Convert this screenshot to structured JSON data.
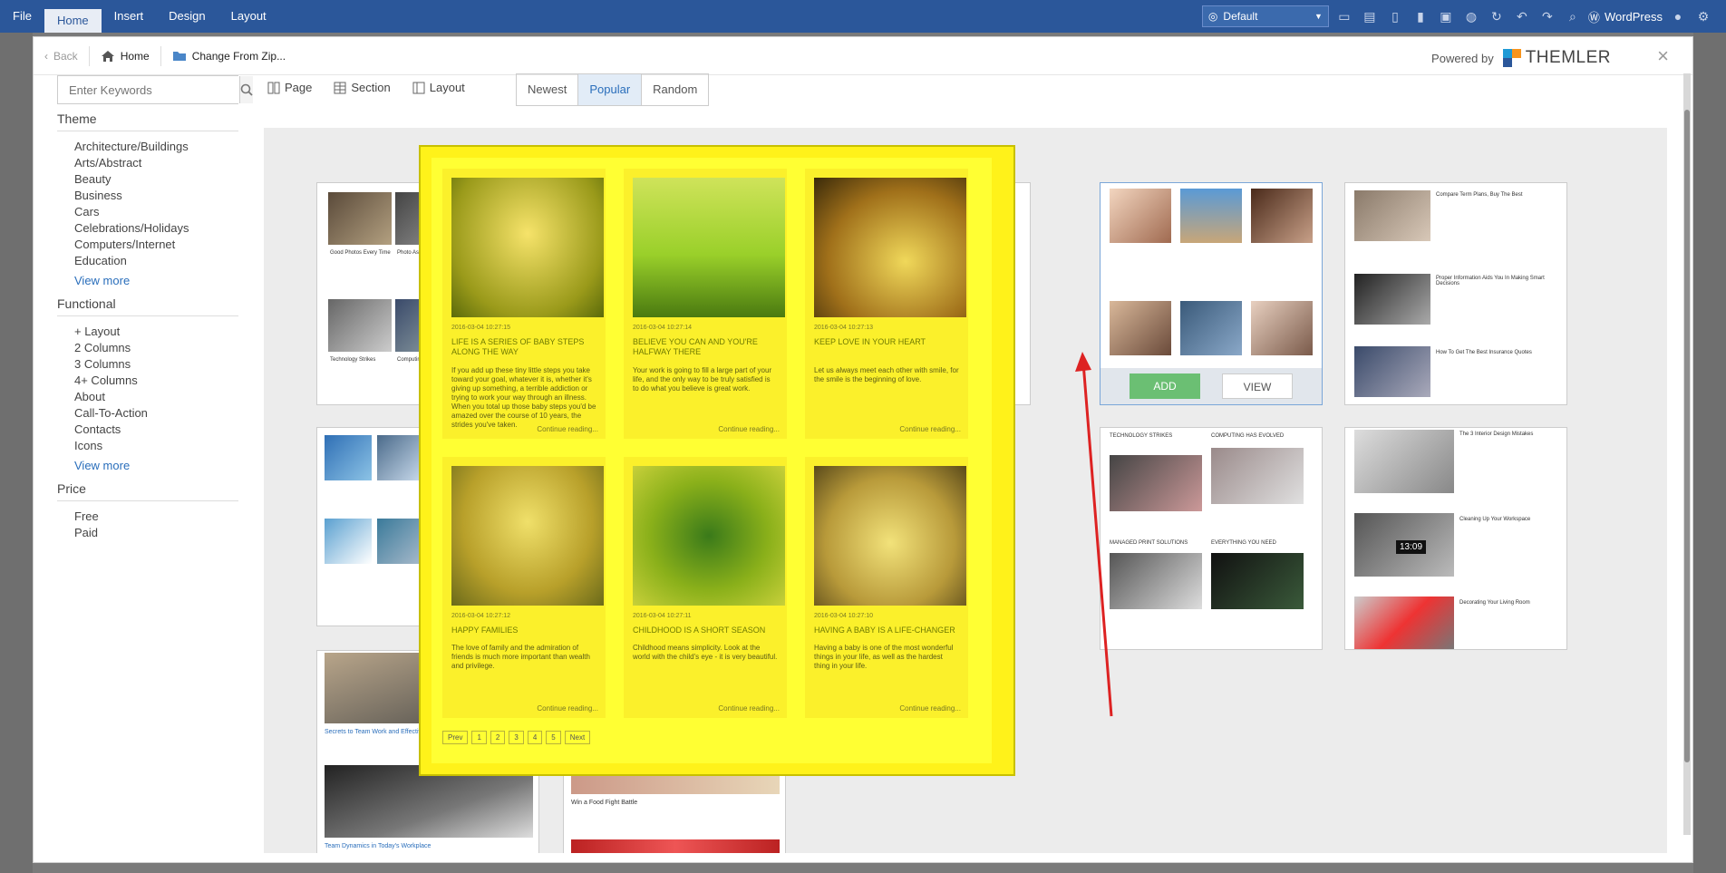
{
  "ribbon": {
    "tabs": [
      "File",
      "Home",
      "Insert",
      "Design",
      "Layout"
    ],
    "active_tab": "Home",
    "style_select": "Default",
    "wordpress_label": "WordPress"
  },
  "dialog": {
    "back_label": "Back",
    "home_label": "Home",
    "change_label": "Change From Zip...",
    "powered_by": "Powered by",
    "logo_text": "THEMLER",
    "close_label": "×"
  },
  "search": {
    "placeholder": "Enter Keywords"
  },
  "sidebar": {
    "theme_head": "Theme",
    "theme_items": [
      "Architecture/Buildings",
      "Arts/Abstract",
      "Beauty",
      "Business",
      "Cars",
      "Celebrations/Holidays",
      "Computers/Internet",
      "Education"
    ],
    "theme_more": "View more",
    "functional_head": "Functional",
    "functional_items": [
      "+ Layout",
      "2 Columns",
      "3 Columns",
      "4+ Columns",
      "About",
      "Call-To-Action",
      "Contacts",
      "Icons"
    ],
    "functional_more": "View more",
    "price_head": "Price",
    "price_items": [
      "Free",
      "Paid"
    ]
  },
  "view_switch": {
    "page": "Page",
    "section": "Section",
    "layout": "Layout"
  },
  "sort": {
    "newest": "Newest",
    "popular": "Popular",
    "random": "Random",
    "active": "Popular"
  },
  "card_buttons": {
    "add": "ADD",
    "view": "VIEW"
  },
  "preview": {
    "posts": [
      {
        "meta": "2016-03-04 10:27:15",
        "title": "LIFE IS A SERIES OF BABY STEPS ALONG THE WAY",
        "text": "If you add up these tiny little steps you take toward your goal, whatever it is, whether it's giving up something, a terrible addiction or trying to work your way through an illness. When you total up those baby steps you'd be amazed over the course of 10 years, the strides you've taken.",
        "more": "Continue reading..."
      },
      {
        "meta": "2016-03-04 10:27:14",
        "title": "BELIEVE YOU CAN AND YOU'RE HALFWAY THERE",
        "text": "Your work is going to fill a large part of your life, and the only way to be truly satisfied is to do what you believe is great work.",
        "more": "Continue reading..."
      },
      {
        "meta": "2016-03-04 10:27:13",
        "title": "KEEP LOVE IN YOUR HEART",
        "text": "Let us always meet each other with smile, for the smile is the beginning of love.",
        "more": "Continue reading..."
      },
      {
        "meta": "2016-03-04 10:27:12",
        "title": "HAPPY FAMILIES",
        "text": "The love of family and the admiration of friends is much more important than wealth and privilege.",
        "more": "Continue reading..."
      },
      {
        "meta": "2016-03-04 10:27:11",
        "title": "CHILDHOOD IS A SHORT SEASON",
        "text": "Childhood means simplicity. Look at the world with the child's eye - it is very beautiful.",
        "more": "Continue reading..."
      },
      {
        "meta": "2016-03-04 10:27:10",
        "title": "HAVING A BABY IS A LIFE-CHANGER",
        "text": "Having a baby is one of the most wonderful things in your life, as well as the hardest thing in your life.",
        "more": "Continue reading..."
      }
    ],
    "pager": [
      "Prev",
      "1",
      "2",
      "3",
      "4",
      "5",
      "Next"
    ]
  },
  "cards_text": {
    "c1": [
      "Good Photos Every Time",
      "Photo Ask About Event",
      "Technology Strikes",
      "Computing Has Evolved"
    ],
    "c5": [
      "Compare Term Plans, Buy The Best",
      "Proper Information Aids You In Making Smart Decisions",
      "How To Get The Best Insurance Quotes"
    ],
    "c7": [
      "TECHNOLOGY STRIKES",
      "COMPUTING HAS EVOLVED",
      "MANAGED PRINT SOLUTIONS",
      "EVERYTHING YOU NEED"
    ],
    "c8": [
      "The 3 Interior Design Mistakes",
      "Cleaning Up Your Workspace",
      "Decorating Your Living Room"
    ],
    "c8_clock": "13:09",
    "c9": [
      "Secrets to Team Work and Effectiveness",
      "Team Dynamics in Today's Workplace"
    ],
    "c10": [
      "Win a Food Fight Battle"
    ]
  }
}
